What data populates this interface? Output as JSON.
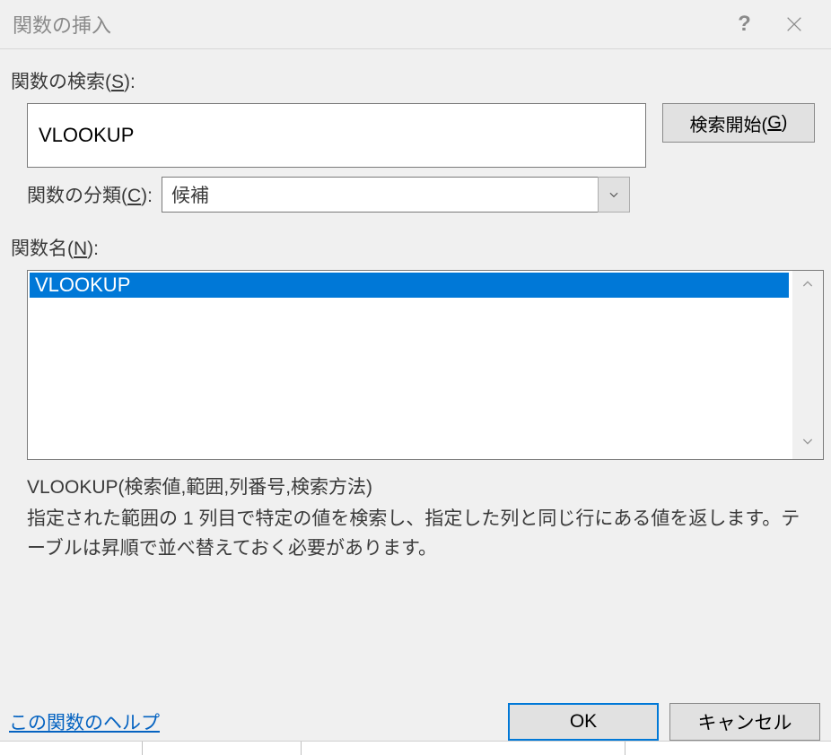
{
  "titlebar": {
    "title": "関数の挿入"
  },
  "search": {
    "label_pre": "関数の検索(",
    "label_key": "S",
    "label_post": "):",
    "value": "VLOOKUP",
    "go_pre": "検索開始(",
    "go_key": "G",
    "go_post": ")"
  },
  "category": {
    "label_pre": "関数の分類(",
    "label_key": "C",
    "label_post": "):",
    "selected": "候補"
  },
  "function_name": {
    "label_pre": "関数名(",
    "label_key": "N",
    "label_post": "):",
    "items": [
      "VLOOKUP"
    ]
  },
  "detail": {
    "syntax": "VLOOKUP(検索値,範囲,列番号,検索方法)",
    "description": "指定された範囲の 1 列目で特定の値を検索し、指定した列と同じ行にある値を返します。テーブルは昇順で並べ替えておく必要があります。"
  },
  "footer": {
    "help_link": "この関数のヘルプ",
    "ok": "OK",
    "cancel": "キャンセル"
  }
}
